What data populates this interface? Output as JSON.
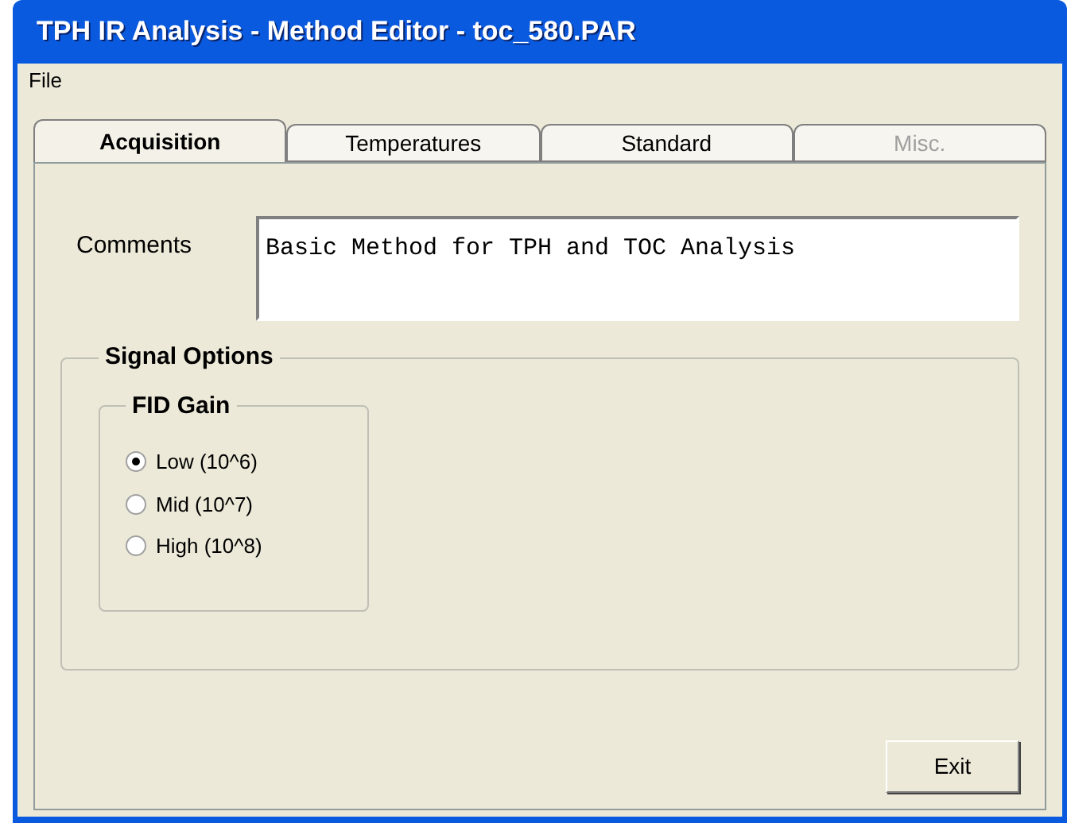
{
  "window": {
    "title": "TPH IR Analysis - Method Editor - toc_580.PAR"
  },
  "menu": [
    "File"
  ],
  "tabs": [
    {
      "label": "Acquisition",
      "selected": true,
      "disabled": false
    },
    {
      "label": "Temperatures",
      "selected": false,
      "disabled": false
    },
    {
      "label": "Standard",
      "selected": false,
      "disabled": false
    },
    {
      "label": "Misc.",
      "selected": false,
      "disabled": true
    }
  ],
  "comments": {
    "label": "Comments",
    "value": "Basic Method for TPH and TOC Analysis"
  },
  "signal_options": {
    "title": "Signal Options",
    "fid_gain": {
      "title": "FID Gain",
      "options": [
        {
          "label": "Low (10^6)",
          "selected": true
        },
        {
          "label": "Mid (10^7)",
          "selected": false
        },
        {
          "label": "High (10^8)",
          "selected": false
        }
      ]
    }
  },
  "buttons": [
    "Exit"
  ]
}
